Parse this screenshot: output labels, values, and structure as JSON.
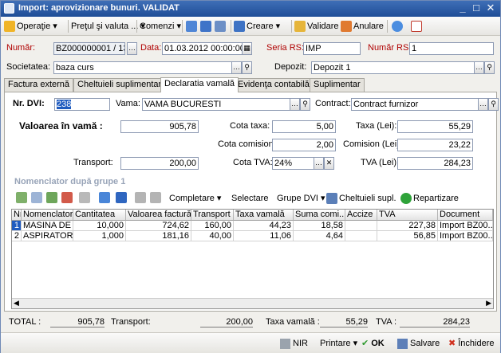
{
  "window": {
    "title": "Import: aprovizionare bunuri. VALIDAT",
    "controls": [
      "_",
      "□",
      "✕"
    ]
  },
  "toolbar": {
    "operatie": "Operaţie",
    "pretul": "Preţul şi valuta ...",
    "comenzi": "Comenzi",
    "creare": "Creare",
    "validare": "Validare",
    "anulare": "Anulare"
  },
  "header": {
    "numar_label": "Număr:",
    "numar_value": "BZ000000001 / 13",
    "data_label": "Data:",
    "data_value": "01.03.2012 00:00:00",
    "seria_label": "Seria RS:",
    "seria_value": "IMP",
    "numar_rs_label": "Număr RS:",
    "numar_rs_value": "1",
    "societatea_label": "Societatea:",
    "societatea_value": "baza curs",
    "depozit_label": "Depozit:",
    "depozit_value": "Depozit 1"
  },
  "tabs": [
    "Factura externă",
    "Cheltuieli suplimentare",
    "Declaratia vamală",
    "Evidenţa contabilă",
    "Suplimentar"
  ],
  "active_tab": 2,
  "dvi": {
    "nr_label": "Nr. DVI:",
    "nr_value": "238",
    "vama_label": "Vama:",
    "vama_value": "VAMA BUCURESTI",
    "contract_label": "Contract:",
    "contract_value": "Contract furnizor",
    "valoarea_label": "Valoarea în vamă :",
    "valoarea_value": "905,78",
    "cota_taxa_label": "Cota taxa:",
    "cota_taxa_value": "5,00",
    "taxa_label": "Taxa (Lei):",
    "taxa_value": "55,29",
    "cota_comision_label": "Cota comision:",
    "cota_comision_value": "2,00",
    "comision_label": "Comision (Lei):",
    "comision_value": "23,22",
    "transport_label": "Transport:",
    "transport_value": "200,00",
    "cota_tva_label": "Cota TVA:",
    "cota_tva_value": "24%",
    "tva_label": "TVA (Lei):",
    "tva_value": "284,23"
  },
  "nomenclator": {
    "title": "Nomenclator după grupe 1",
    "toolbar": {
      "completare": "Completare",
      "selectare": "Selectare",
      "grupe": "Grupe DVI",
      "cheltuieli": "Cheltuieli supl.",
      "repartizare": "Repartizare"
    },
    "columns": [
      "Nr.",
      "Nomenclator",
      "Cantitatea",
      "Valoarea factură",
      "Transport",
      "Taxa vamală",
      "Suma comi...",
      "Accize",
      "TVA",
      "Document"
    ],
    "rows": [
      [
        "1",
        "MASINA DE ...",
        "10,000",
        "724,62",
        "160,00",
        "44,23",
        "18,58",
        "",
        "227,38",
        "Import BZ00..."
      ],
      [
        "2",
        "ASPIRATOR",
        "1,000",
        "181,16",
        "40,00",
        "11,06",
        "4,64",
        "",
        "56,85",
        "Import BZ00..."
      ]
    ]
  },
  "totals": {
    "total_label": "TOTAL :",
    "total_value": "905,78",
    "transport_label": "Transport:",
    "transport_value": "200,00",
    "taxa_label": "Taxa vamală :",
    "taxa_value": "55,29",
    "tva_label": "TVA :",
    "tva_value": "284,23"
  },
  "footer": {
    "nir": "NIR",
    "printare": "Printare",
    "ok": "OK",
    "salvare": "Salvare",
    "inchidere": "Închidere"
  }
}
